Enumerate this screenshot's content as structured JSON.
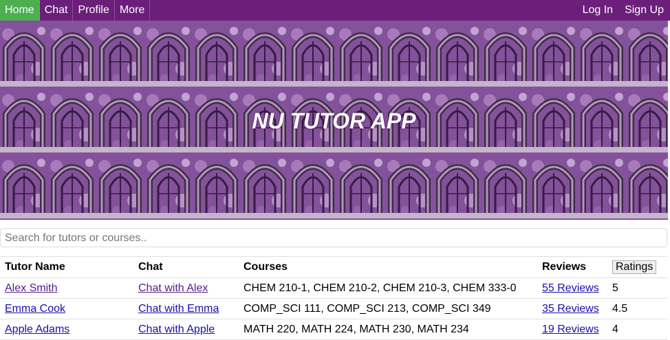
{
  "nav": {
    "left": [
      "Home",
      "Chat",
      "Profile",
      "More"
    ],
    "right": [
      "Log In",
      "Sign Up"
    ],
    "active": "Home"
  },
  "banner": {
    "title": "NU TUTOR APP"
  },
  "search": {
    "placeholder": "Search for tutors or courses.."
  },
  "table": {
    "headers": {
      "name": "Tutor Name",
      "chat": "Chat",
      "courses": "Courses",
      "reviews": "Reviews",
      "ratings": "Ratings"
    },
    "rows": [
      {
        "name": "Alex Smith",
        "chat": "Chat with Alex",
        "courses": "CHEM 210-1, CHEM 210-2, CHEM 210-3, CHEM 333-0",
        "reviews": "55 Reviews",
        "rating": "5"
      },
      {
        "name": "Emma Cook",
        "chat": "Chat with Emma",
        "courses": "COMP_SCI 111, COMP_SCI 213, COMP_SCI 349",
        "reviews": "35 Reviews",
        "rating": "4.5"
      },
      {
        "name": "Apple Adams",
        "chat": "Chat with Apple",
        "courses": "MATH 220, MATH 224, MATH 230, MATH 234",
        "reviews": "19 Reviews",
        "rating": "4"
      }
    ]
  },
  "colors": {
    "nav_bg": "#6b1f7a",
    "nav_active": "#4caf50",
    "link": "#1a0dab",
    "visited_link": "#551a8b"
  }
}
